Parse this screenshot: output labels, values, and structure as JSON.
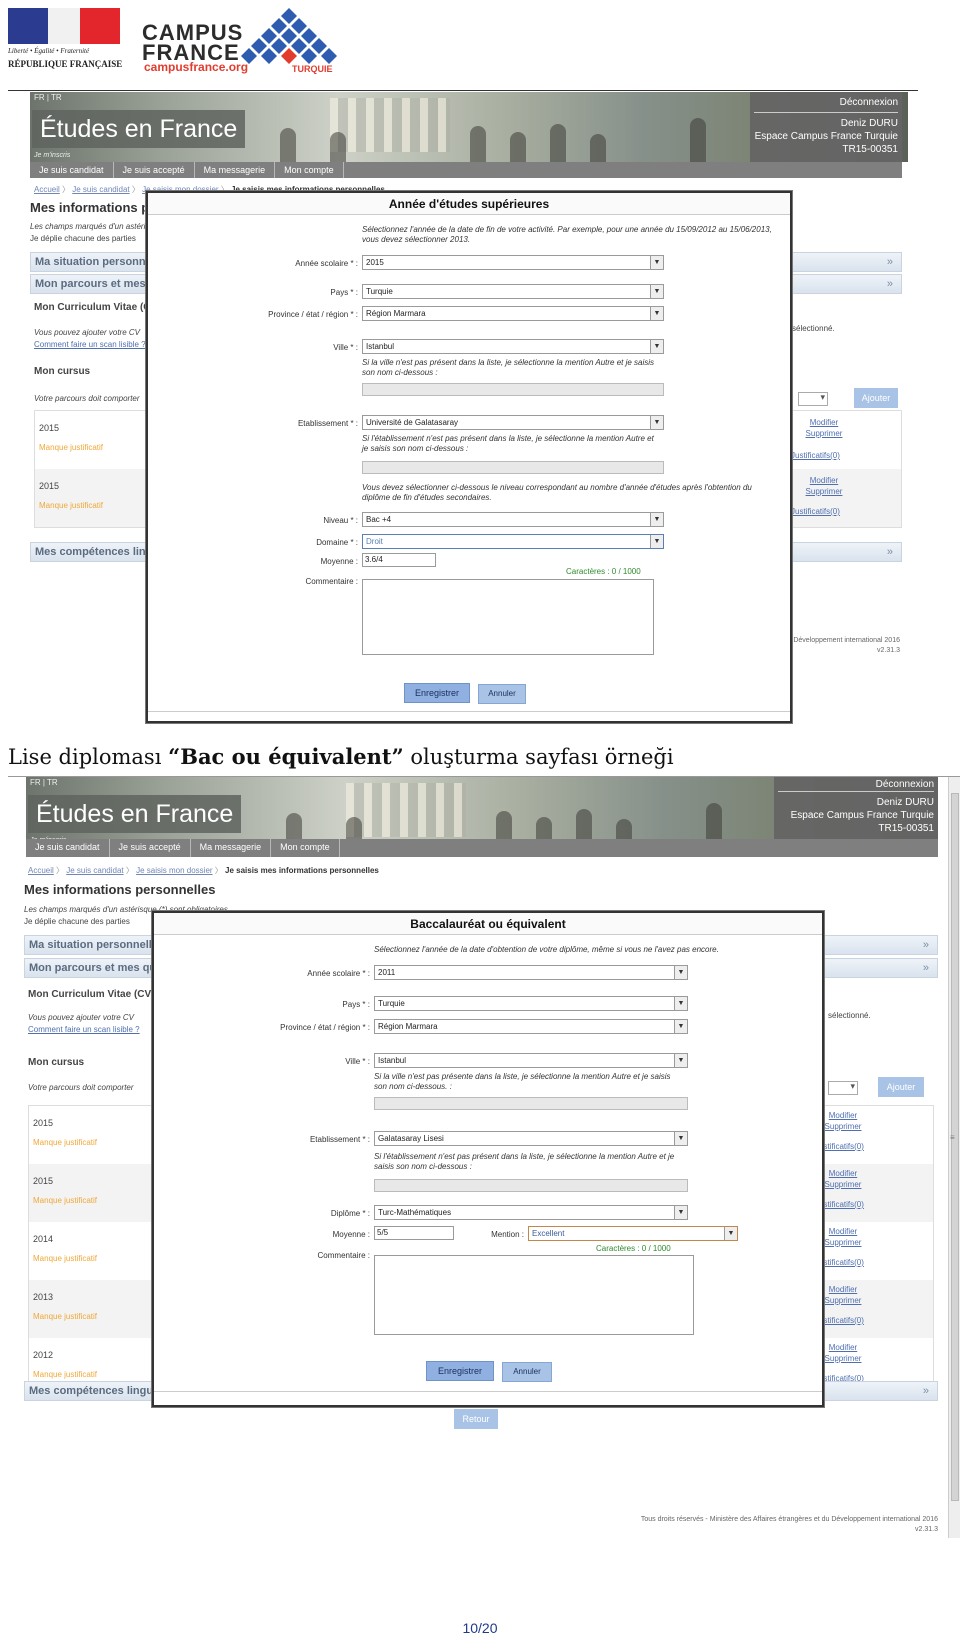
{
  "header": {
    "rf_motto": "Liberté • Égalité • Fraternité",
    "rf_name": "RÉPUBLIQUE FRANÇAISE",
    "cf_line1": "CAMPUS",
    "cf_line2": "FRANCE",
    "cf_url": "campusfrance.org",
    "cf_country": "TURQUIE"
  },
  "caption": {
    "prefix": "Lise diploması ",
    "bold": "“Bac ou équivalent”",
    "suffix": " oluşturma sayfası örneği"
  },
  "page_number": "10/20",
  "site": {
    "lang": "FR | TR",
    "title": "Études en France",
    "mini_link": "Je m'inscris",
    "logout": "Déconnexion",
    "user_name": "Deniz DURU",
    "espace": "Espace Campus France Turquie",
    "user_id": "TR15-00351",
    "tabs": [
      "Je suis candidat",
      "Je suis accepté",
      "Ma messagerie",
      "Mon compte"
    ],
    "breadcrumb": [
      "Accueil",
      "Je suis candidat",
      "Je saisis mon dossier",
      "Je saisis mes informations personnelles"
    ],
    "page_heading": "Mes informations personnelles",
    "intro1": "Les champs marqués d'un astérisque (*) sont obligatoires.",
    "intro2": "Je déplie chacune des parties",
    "sections": {
      "situation": "Ma situation personnelle",
      "parcours": "Mon parcours et mes qualifications",
      "competences": "Mes compétences linguistiques",
      "manque": "Manque justificatif"
    },
    "cv_heading": "Mon Curriculum Vitae (CV)",
    "cv_text": "Vous pouvez ajouter votre CV",
    "cv_link": "Comment faire un scan lisible ?",
    "cv_selected": "sélectionné.",
    "cursus_heading": "Mon cursus",
    "cursus_text": "Votre parcours doit comporter",
    "ajouter": "Ajouter",
    "modifier": "Modifier",
    "supprimer": "Supprimer",
    "justificatifs": "Justificatifs(0)",
    "retour": "Retour",
    "footer_line1": "Tous droits réservés - Ministère des Affaires étrangères et du Développement international 2016",
    "footer_line1_short": "Développement international 2016",
    "version": "v2.31.3"
  },
  "shot1": {
    "years": [
      "2015",
      "2015"
    ],
    "modal": {
      "title": "Année d'études supérieures",
      "help_top": "Sélectionnez l'année de la date de fin de votre activité. Par exemple, pour une année du 15/09/2012 au 15/06/2013, vous devez sélectionner 2013.",
      "annee_label": "Année scolaire * :",
      "annee_value": "2015",
      "pays_label": "Pays * :",
      "pays_value": "Turquie",
      "province_label": "Province / état / région * :",
      "province_value": "Région Marmara",
      "ville_label": "Ville * :",
      "ville_value": "Istanbul",
      "ville_help": "Si la ville n'est pas présent dans la liste, je sélectionne la mention Autre et je saisis son nom ci-dessous :",
      "etab_label": "Etablissement * :",
      "etab_value": "Université de Galatasaray",
      "etab_help": "Si l'établissement n'est pas présent dans la liste, je sélectionne la mention Autre et je saisis son nom ci-dessous :",
      "niveau_help": "Vous devez sélectionner ci-dessous le niveau correspondant au nombre d'année d'études après l'obtention du diplôme de fin d'études secondaires.",
      "niveau_label": "Niveau * :",
      "niveau_value": "Bac +4",
      "domaine_label": "Domaine * :",
      "domaine_value": "Droit",
      "moyenne_label": "Moyenne :",
      "moyenne_value": "3.6/4",
      "commentaire_label": "Commentaire :",
      "counter": "Caractères : 0 / 1000",
      "save": "Enregistrer",
      "cancel": "Annuler"
    }
  },
  "shot2": {
    "years": [
      "2015",
      "2015",
      "2014",
      "2013",
      "2012"
    ],
    "modal": {
      "title": "Baccalauréat ou équivalent",
      "help_top": "Sélectionnez l'année de la date d'obtention de votre diplôme, même si vous ne l'avez pas encore.",
      "annee_label": "Année scolaire * :",
      "annee_value": "2011",
      "pays_label": "Pays * :",
      "pays_value": "Turquie",
      "province_label": "Province / état / région * :",
      "province_value": "Région Marmara",
      "ville_label": "Ville * :",
      "ville_value": "Istanbul",
      "ville_help": "Si la ville n'est pas présente dans la liste, je sélectionne la mention Autre et je saisis son nom ci-dessous. :",
      "etab_label": "Etablissement * :",
      "etab_value": "Galatasaray Lisesi",
      "etab_help": "Si l'établissement n'est pas présent dans la liste, je sélectionne la mention Autre et je saisis son nom ci-dessous :",
      "diplome_label": "Diplôme * :",
      "diplome_value": "Turc-Mathématiques",
      "moyenne_label": "Moyenne :",
      "moyenne_value": "5/5",
      "mention_label": "Mention :",
      "mention_value": "Excellent",
      "commentaire_label": "Commentaire :",
      "counter": "Caractères : 0 / 1000",
      "save": "Enregistrer",
      "cancel": "Annuler"
    }
  }
}
